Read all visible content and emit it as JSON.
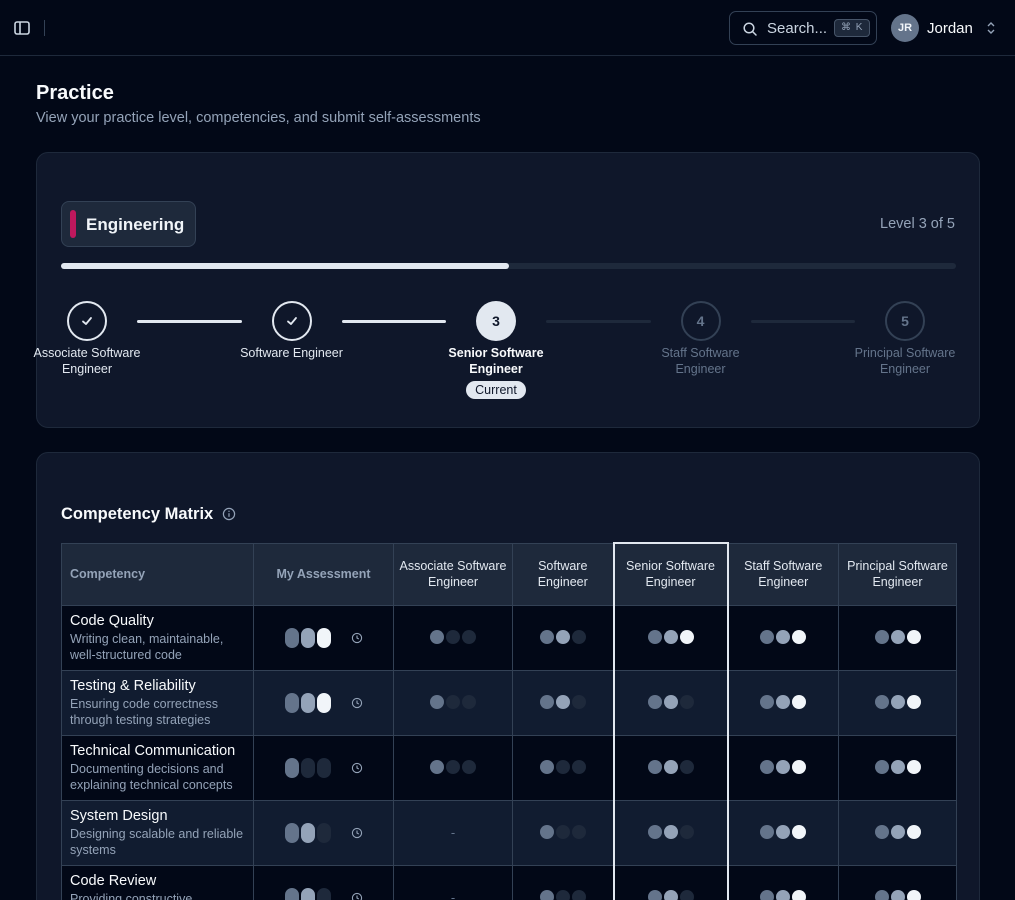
{
  "header": {
    "search_placeholder": "Search...",
    "search_shortcut": "⌘ K",
    "user_initials": "JR",
    "user_name": "Jordan"
  },
  "page": {
    "title": "Practice",
    "subtitle": "View your practice level, competencies, and submit self-assessments"
  },
  "practice": {
    "name": "Engineering",
    "accent_color": "#be185d",
    "level_text": "Level 3 of 5",
    "progress_fraction": 0.5,
    "current_label": "Current",
    "steps": [
      {
        "number": "1",
        "name": "Associate Software Engineer",
        "state": "done"
      },
      {
        "number": "2",
        "name": "Software Engineer",
        "state": "done"
      },
      {
        "number": "3",
        "name": "Senior Software Engineer",
        "state": "current"
      },
      {
        "number": "4",
        "name": "Staff Software Engineer",
        "state": "future"
      },
      {
        "number": "5",
        "name": "Principal Software Engineer",
        "state": "future"
      }
    ]
  },
  "matrix": {
    "title": "Competency Matrix",
    "headers": [
      "Competency",
      "My Assessment",
      "Associate Software Engineer",
      "Software Engineer",
      "Senior Software Engineer",
      "Staff Software Engineer",
      "Principal Software Engineer"
    ],
    "highlight_column": 4,
    "rows": [
      {
        "name": "Code Quality",
        "description": "Writing clean, maintainable, well-structured code",
        "assessment": 3,
        "levels": [
          1,
          2,
          3,
          3,
          3
        ]
      },
      {
        "name": "Testing & Reliability",
        "description": "Ensuring code correctness through testing strategies",
        "assessment": 3,
        "levels": [
          1,
          2,
          2,
          3,
          3
        ]
      },
      {
        "name": "Technical Communication",
        "description": "Documenting decisions and explaining technical concepts",
        "assessment": 1,
        "levels": [
          1,
          1,
          2,
          3,
          3
        ]
      },
      {
        "name": "System Design",
        "description": "Designing scalable and reliable systems",
        "assessment": 2,
        "levels": [
          null,
          1,
          2,
          3,
          3
        ]
      },
      {
        "name": "Code Review",
        "description": "Providing constructive feedback",
        "assessment": 2,
        "levels": [
          null,
          1,
          2,
          3,
          3
        ]
      }
    ]
  }
}
